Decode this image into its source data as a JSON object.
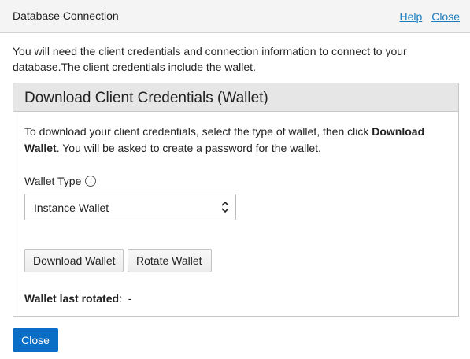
{
  "header": {
    "title": "Database Connection",
    "help_link": "Help",
    "close_link": "Close"
  },
  "intro": "You will need the client credentials and connection information to connect to your database.The client credentials include the wallet.",
  "panel": {
    "title": "Download Client Credentials (Wallet)",
    "desc_pre": "To download your client credentials, select the type of wallet, then click ",
    "desc_bold": "Download Wallet",
    "desc_post": ". You will be asked to create a password for the wallet.",
    "wallet_type_label": "Wallet Type",
    "wallet_type_info_icon": "info-icon",
    "wallet_type_value": "Instance Wallet",
    "download_button": "Download Wallet",
    "rotate_button": "Rotate Wallet",
    "last_rotated_label": "Wallet last rotated",
    "last_rotated_sep": ":",
    "last_rotated_value": "-"
  },
  "footer": {
    "close_button": "Close"
  },
  "colors": {
    "link": "#1a7cbd",
    "primary_button": "#0a6ec6",
    "panel_header_bg": "#e6e6e6"
  }
}
